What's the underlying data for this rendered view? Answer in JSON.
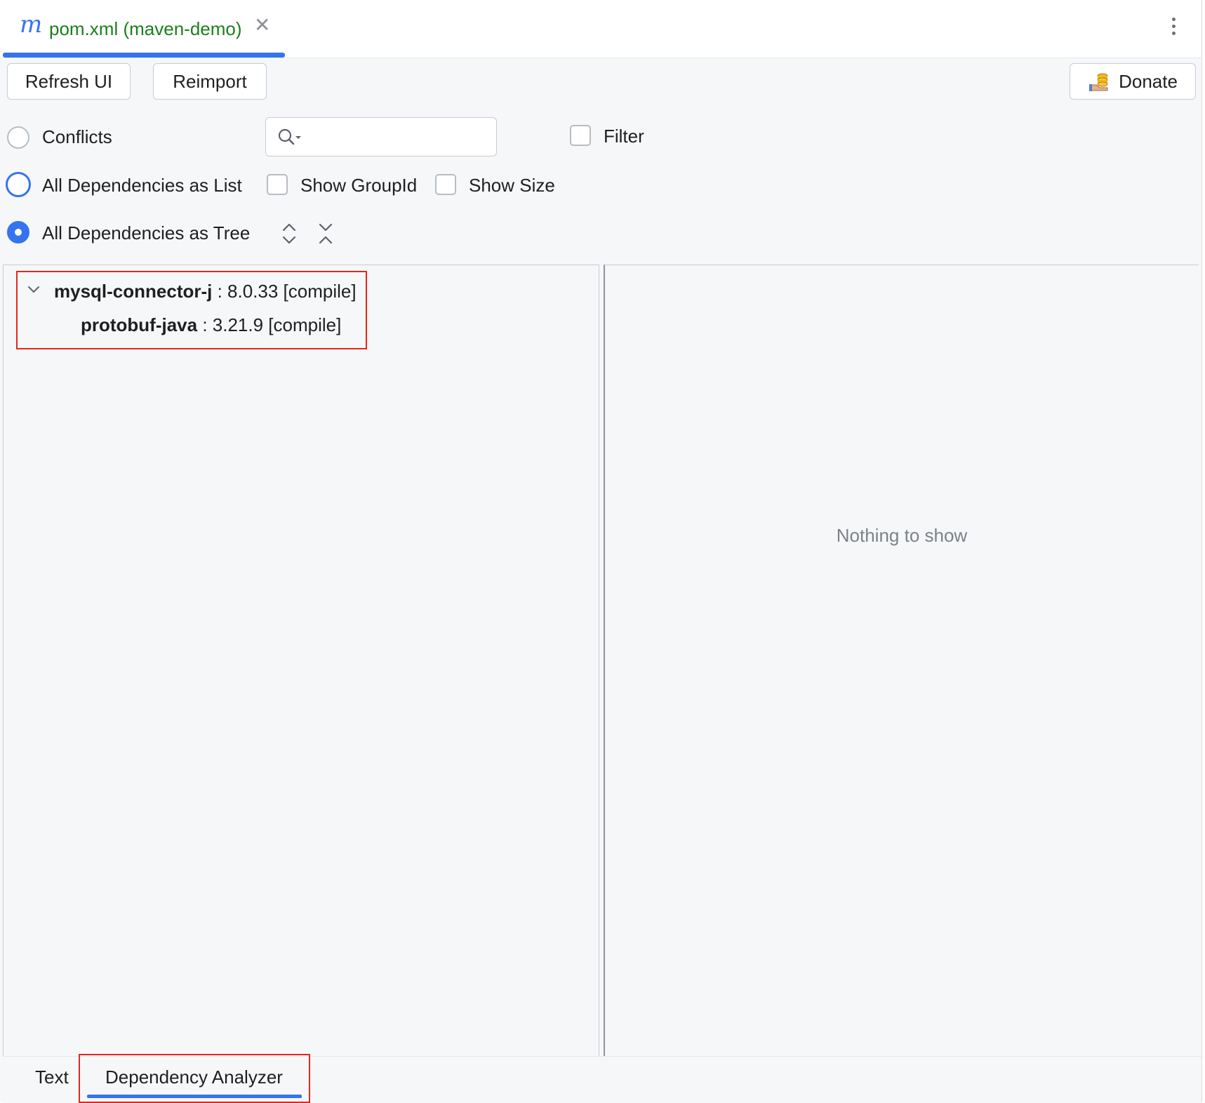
{
  "editor_tab": {
    "icon": "maven-m-icon",
    "title": "pom.xml (maven-demo)",
    "title_color": "#1a7f1a",
    "accent": "#3574f0"
  },
  "toolbar": {
    "refresh_label": "Refresh UI",
    "reimport_label": "Reimport",
    "donate_label": "Donate"
  },
  "options": {
    "conflicts_label": "Conflicts",
    "list_label": "All Dependencies as List",
    "tree_label": "All Dependencies as Tree",
    "selected_mode": "All Dependencies as Tree",
    "search_placeholder": "",
    "filter_label": "Filter",
    "show_groupid_label": "Show GroupId",
    "show_size_label": "Show Size"
  },
  "tree": {
    "items": [
      {
        "artifact": "mysql-connector-j",
        "detail": " : 8.0.33 [compile]",
        "expanded": true
      },
      {
        "artifact": "protobuf-java",
        "detail": " : 3.21.9 [compile]"
      }
    ]
  },
  "details_panel": {
    "empty_text": "Nothing to show"
  },
  "bottom_tabs": {
    "text_label": "Text",
    "analyzer_label": "Dependency Analyzer",
    "active": "Dependency Analyzer"
  },
  "colors": {
    "accent": "#3574f0",
    "highlight_box": "#e0281f"
  }
}
